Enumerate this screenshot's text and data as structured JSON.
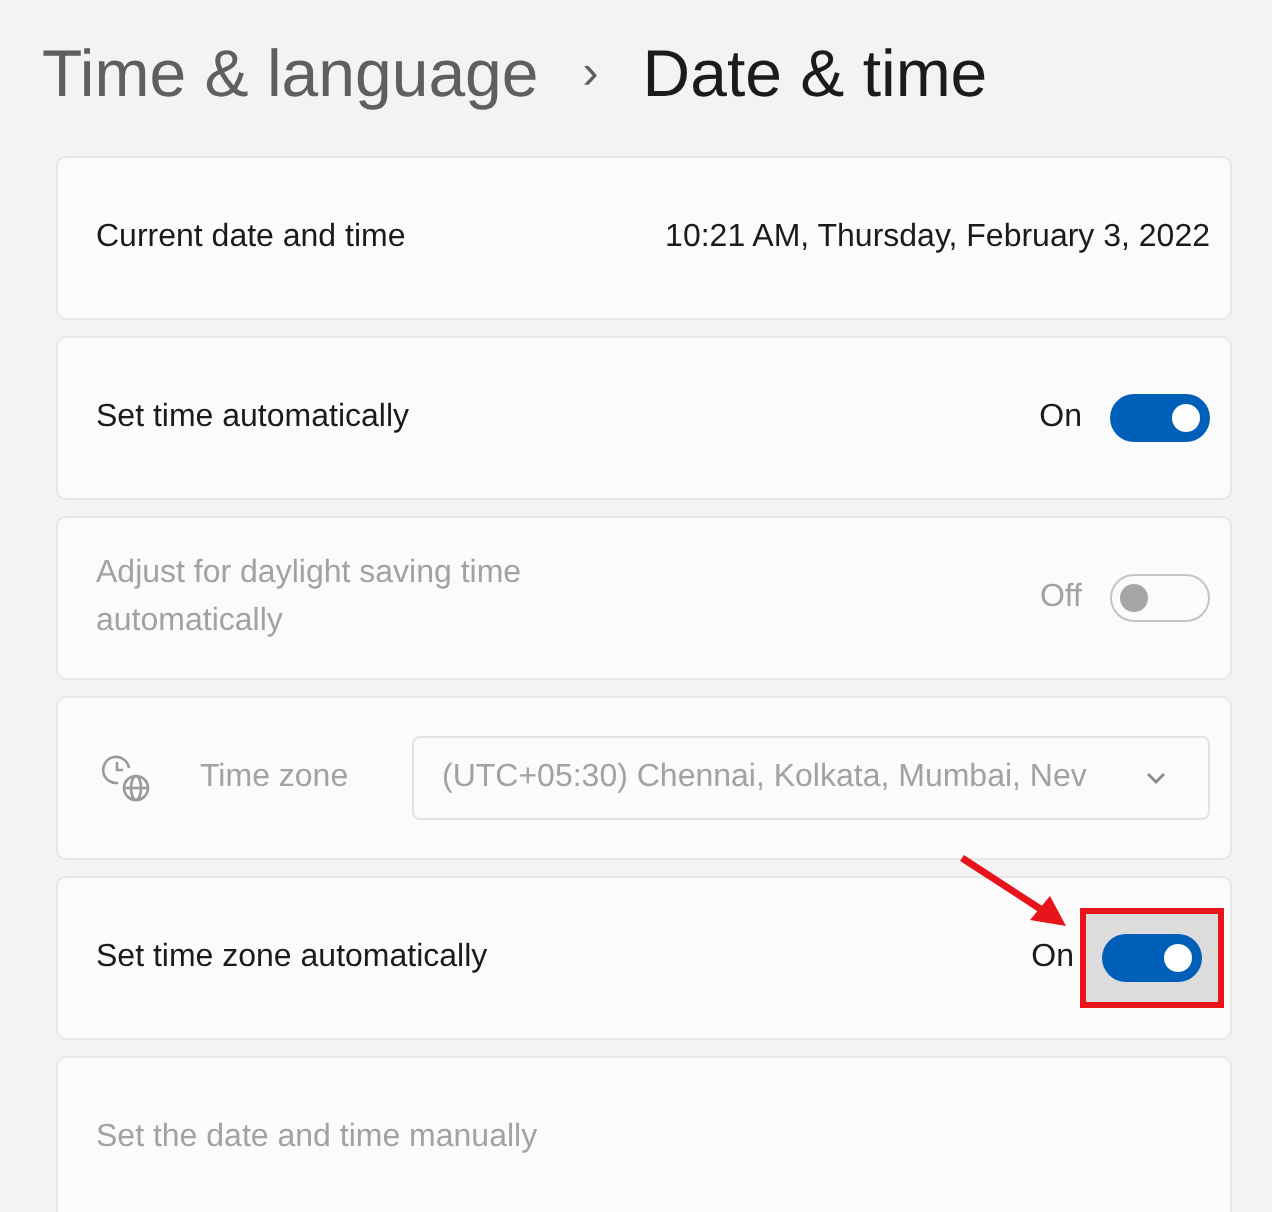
{
  "breadcrumb": {
    "parent": "Time & language",
    "separator": "›",
    "current": "Date & time"
  },
  "rows": [
    {
      "kind": "info",
      "label": "Current date and time",
      "value": "10:21 AM, Thursday, February 3, 2022",
      "disabled": false
    },
    {
      "kind": "toggle",
      "label": "Set time automatically",
      "state_text": "On",
      "on": true,
      "disabled": false,
      "highlighted": false
    },
    {
      "kind": "toggle",
      "label": "Adjust for daylight saving time automatically",
      "state_text": "Off",
      "on": false,
      "disabled": true,
      "highlighted": false
    },
    {
      "kind": "dropdown",
      "label": "Time zone",
      "value": "(UTC+05:30) Chennai, Kolkata, Mumbai, Nev",
      "disabled": true
    },
    {
      "kind": "toggle",
      "label": "Set time zone automatically",
      "state_text": "On",
      "on": true,
      "disabled": false,
      "highlighted": true
    },
    {
      "kind": "action",
      "label": "Set the date and time manually",
      "disabled": true
    }
  ]
}
